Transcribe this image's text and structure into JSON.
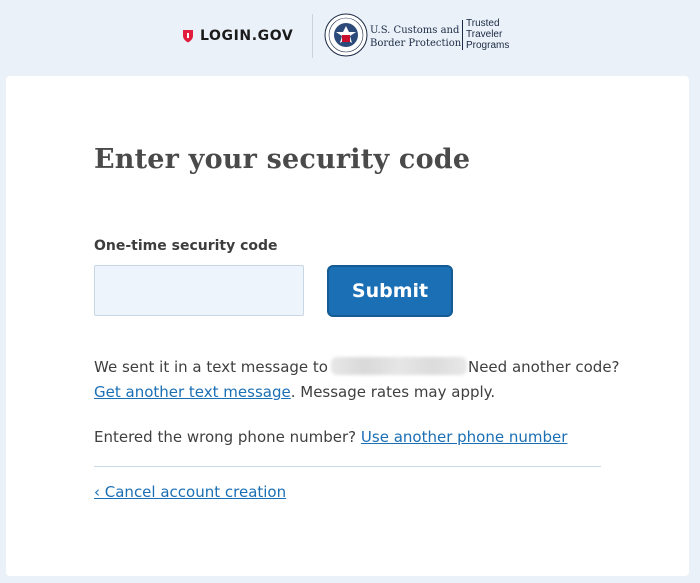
{
  "header": {
    "login_logo_text": "LOGIN.GOV",
    "agency_line1": "U.S. Customs and",
    "agency_line2": "Border Protection",
    "program_line1": "Trusted",
    "program_line2": "Traveler",
    "program_line3": "Programs",
    "icons": [
      "shield-icon",
      "dhs-seal-icon"
    ]
  },
  "card": {
    "title": "Enter your security code",
    "code_label": "One-time security code",
    "code_value": "",
    "submit_label": "Submit",
    "sent_text_prefix": "We sent it in a text message to",
    "sent_text_suffix": "Need another code?",
    "resend_link": "Get another text message",
    "rates_text": ". Message rates may apply.",
    "wrong_number_text": "Entered the wrong phone number?",
    "other_phone_link": "Use another phone number",
    "cancel_link": "‹ Cancel account creation"
  },
  "colors": {
    "page_bg": "#eaf1f8",
    "primary": "#1a6fb5",
    "login_red": "#e21c3d",
    "text": "#3f3f3f"
  }
}
